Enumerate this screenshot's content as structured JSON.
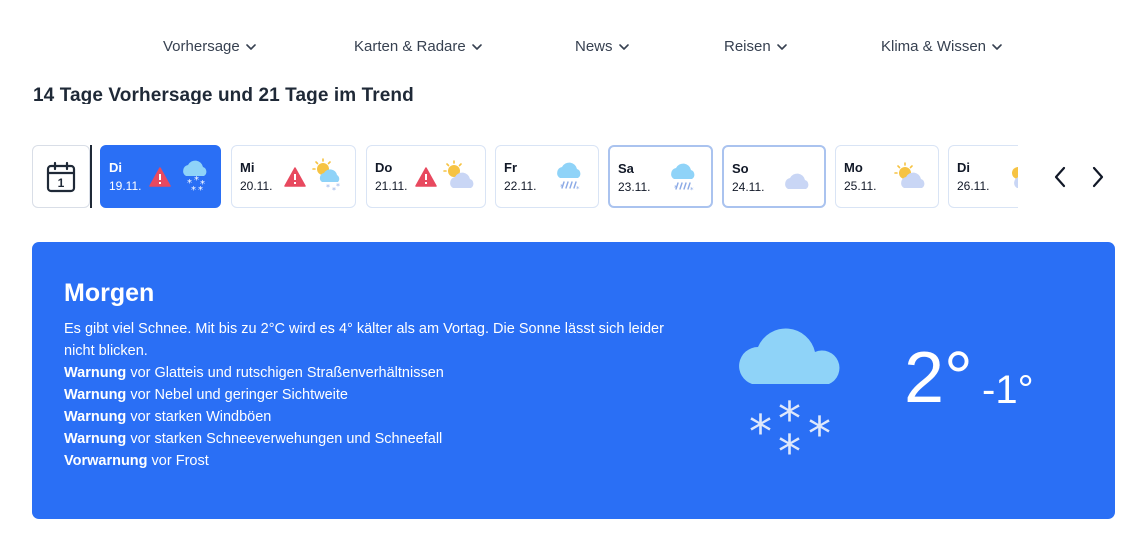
{
  "nav": {
    "items": [
      {
        "label": "Vorhersage"
      },
      {
        "label": "Karten & Radare"
      },
      {
        "label": "News"
      },
      {
        "label": "Reisen"
      },
      {
        "label": "Klima & Wissen"
      }
    ]
  },
  "subheading": "14 Tage Vorhersage und 21 Tage im Trend",
  "calendar": {
    "icon": "calendar-icon",
    "day_number": "1"
  },
  "days": [
    {
      "name": "Di",
      "date": "19.11.",
      "warning": true,
      "icon": "cloud-snow-icon",
      "state": "active"
    },
    {
      "name": "Mi",
      "date": "20.11.",
      "warning": true,
      "icon": "sun-cloud-snow-icon",
      "state": "default"
    },
    {
      "name": "Do",
      "date": "21.11.",
      "warning": true,
      "icon": "sun-cloud-icon",
      "state": "default"
    },
    {
      "name": "Fr",
      "date": "22.11.",
      "warning": false,
      "icon": "cloud-sleet-icon",
      "state": "default"
    },
    {
      "name": "Sa",
      "date": "23.11.",
      "warning": false,
      "icon": "cloud-sleet-icon",
      "state": "outlined"
    },
    {
      "name": "So",
      "date": "24.11.",
      "warning": false,
      "icon": "cloud-icon",
      "state": "outlined"
    },
    {
      "name": "Mo",
      "date": "25.11.",
      "warning": false,
      "icon": "sun-cloud-icon",
      "state": "default"
    },
    {
      "name": "Di",
      "date": "26.11.",
      "warning": false,
      "icon": "sun-cloud-icon",
      "state": "default"
    }
  ],
  "colors": {
    "accent": "#2a6ff5",
    "warning": "#e8495f",
    "cloud": "#8fd3f8",
    "cloud_grey": "#c9d6f5"
  },
  "panel": {
    "title": "Morgen",
    "description": "Es gibt viel Schnee. Mit bis zu 2°C wird es 4° kälter als am Vortag. Die Sonne lässt sich leider nicht blicken.",
    "warnings": [
      {
        "level": "Warnung",
        "text": " vor Glatteis und rutschigen Straßenverhältnissen"
      },
      {
        "level": "Warnung",
        "text": " vor Nebel und geringer Sichtweite"
      },
      {
        "level": "Warnung",
        "text": " vor starken Windböen"
      },
      {
        "level": "Warnung",
        "text": " vor starken Schneeverwehungen und Schneefall"
      },
      {
        "level": "Vorwarnung",
        "text": " vor Frost"
      }
    ],
    "icon": "cloud-snow-icon",
    "temp_max": "2°",
    "temp_min": "-1°"
  }
}
